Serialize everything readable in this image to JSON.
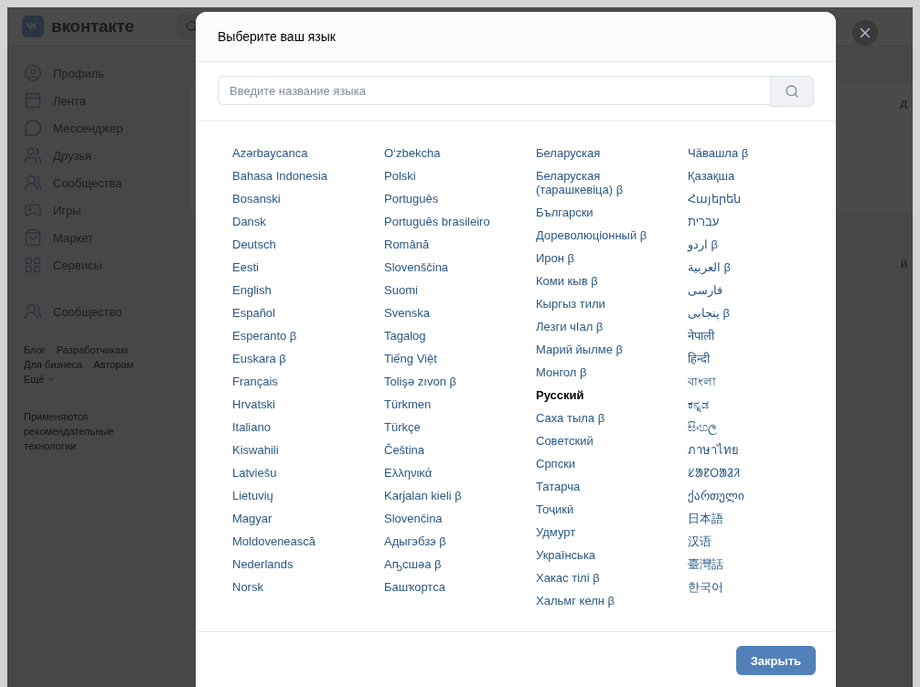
{
  "header": {
    "logo_text": "вконтакте"
  },
  "sidebar": {
    "items": [
      {
        "label": "Профиль"
      },
      {
        "label": "Лента"
      },
      {
        "label": "Мессенджер"
      },
      {
        "label": "Друзья"
      },
      {
        "label": "Сообщества"
      },
      {
        "label": "Игры"
      },
      {
        "label": "Маркет"
      },
      {
        "label": "Сервисы"
      }
    ],
    "extra_items": [
      {
        "label": "Сообщество"
      }
    ],
    "footer_links": [
      "Блог",
      "Разработчикам",
      "Для бизнеса",
      "Авторам",
      "Ещё"
    ],
    "note": "Применяются рекомендательные технологии"
  },
  "background_fragments": [
    "д",
    "й"
  ],
  "dialog": {
    "title": "Выберите ваш язык",
    "search": {
      "placeholder": "Введите название языка"
    },
    "columns": [
      [
        {
          "name": "Azərbaycanca",
          "selected": false
        },
        {
          "name": "Bahasa Indonesia",
          "selected": false
        },
        {
          "name": "Bosanski",
          "selected": false
        },
        {
          "name": "Dansk",
          "selected": false
        },
        {
          "name": "Deutsch",
          "selected": false
        },
        {
          "name": "Eesti",
          "selected": false
        },
        {
          "name": "English",
          "selected": false
        },
        {
          "name": "Español",
          "selected": false
        },
        {
          "name": "Esperanto β",
          "selected": false
        },
        {
          "name": "Euskara β",
          "selected": false
        },
        {
          "name": "Français",
          "selected": false
        },
        {
          "name": "Hrvatski",
          "selected": false
        },
        {
          "name": "Italiano",
          "selected": false
        },
        {
          "name": "Kiswahili",
          "selected": false
        },
        {
          "name": "Latviešu",
          "selected": false
        },
        {
          "name": "Lietuvių",
          "selected": false
        },
        {
          "name": "Magyar",
          "selected": false
        },
        {
          "name": "Moldovenească",
          "selected": false
        },
        {
          "name": "Nederlands",
          "selected": false
        },
        {
          "name": "Norsk",
          "selected": false
        }
      ],
      [
        {
          "name": "O‘zbekcha",
          "selected": false
        },
        {
          "name": "Polski",
          "selected": false
        },
        {
          "name": "Português",
          "selected": false
        },
        {
          "name": "Português brasileiro",
          "selected": false
        },
        {
          "name": "Română",
          "selected": false
        },
        {
          "name": "Slovenščina",
          "selected": false
        },
        {
          "name": "Suomi",
          "selected": false
        },
        {
          "name": "Svenska",
          "selected": false
        },
        {
          "name": "Tagalog",
          "selected": false
        },
        {
          "name": "Tiếng Việt",
          "selected": false
        },
        {
          "name": "Tolişə zıvon β",
          "selected": false
        },
        {
          "name": "Türkmen",
          "selected": false
        },
        {
          "name": "Türkçe",
          "selected": false
        },
        {
          "name": "Čeština",
          "selected": false
        },
        {
          "name": "Ελληνικά",
          "selected": false
        },
        {
          "name": "Karjalan kieli β",
          "selected": false
        },
        {
          "name": "Slovenčina",
          "selected": false
        },
        {
          "name": "Адыгэбзэ β",
          "selected": false
        },
        {
          "name": "Аҧсшәа β",
          "selected": false
        },
        {
          "name": "Башҡортса",
          "selected": false
        }
      ],
      [
        {
          "name": "Беларуская",
          "selected": false
        },
        {
          "name": "Беларуская (тарашкевіца) β",
          "selected": false
        },
        {
          "name": "Български",
          "selected": false
        },
        {
          "name": "Дореволюціонный β",
          "selected": false
        },
        {
          "name": "Ирон β",
          "selected": false
        },
        {
          "name": "Коми кыв β",
          "selected": false
        },
        {
          "name": "Кыргыз тили",
          "selected": false
        },
        {
          "name": "Лезги чӀал β",
          "selected": false
        },
        {
          "name": "Марий йылме β",
          "selected": false
        },
        {
          "name": "Монгол β",
          "selected": false
        },
        {
          "name": "Русский",
          "selected": true
        },
        {
          "name": "Саха тыла β",
          "selected": false
        },
        {
          "name": "Советский",
          "selected": false
        },
        {
          "name": "Српски",
          "selected": false
        },
        {
          "name": "Татарча",
          "selected": false
        },
        {
          "name": "Тоҷикӣ",
          "selected": false
        },
        {
          "name": "Удмурт",
          "selected": false
        },
        {
          "name": "Українська",
          "selected": false
        },
        {
          "name": "Хакас тілі β",
          "selected": false
        },
        {
          "name": "Хальмг келн β",
          "selected": false
        }
      ],
      [
        {
          "name": "Чӑвашла β",
          "selected": false
        },
        {
          "name": "Қазақша",
          "selected": false
        },
        {
          "name": "Հայերեն",
          "selected": false
        },
        {
          "name": "עברית",
          "selected": false
        },
        {
          "name": "اردو β",
          "selected": false
        },
        {
          "name": "العربية β",
          "selected": false
        },
        {
          "name": "فارسی",
          "selected": false
        },
        {
          "name": "پنجابی β",
          "selected": false
        },
        {
          "name": "नेपाली",
          "selected": false
        },
        {
          "name": "हिन्दी",
          "selected": false
        },
        {
          "name": "বাংলা",
          "selected": false
        },
        {
          "name": "ಕನ್ನಡ",
          "selected": false
        },
        {
          "name": "සිංහල",
          "selected": false
        },
        {
          "name": "ภาษาไทย",
          "selected": false
        },
        {
          "name": "ᱥᱟᱱᱛᱟᱲᱤ",
          "selected": false
        },
        {
          "name": "ქართული",
          "selected": false
        },
        {
          "name": "日本語",
          "selected": false
        },
        {
          "name": "汉语",
          "selected": false
        },
        {
          "name": "臺灣話",
          "selected": false
        },
        {
          "name": "한국어",
          "selected": false
        }
      ]
    ],
    "close_button": "Закрыть"
  }
}
